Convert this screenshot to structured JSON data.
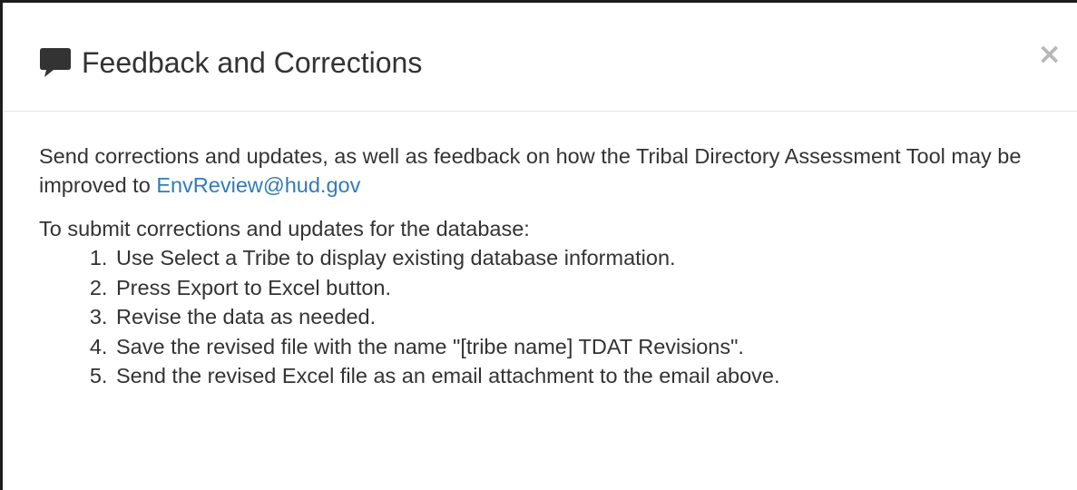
{
  "modal": {
    "title": "Feedback and Corrections",
    "close_label": "×",
    "title_icon": "comment-icon"
  },
  "body": {
    "intro_text": "Send corrections and updates, as well as feedback on how the Tribal Directory Assessment Tool may be improved to ",
    "email_link": "EnvReview@hud.gov",
    "steps_heading": "To submit corrections and updates for the database:",
    "steps": [
      "Use Select a Tribe to display existing database information.",
      "Press Export to Excel button.",
      "Revise the data as needed.",
      "Save the revised file with the name \"[tribe name] TDAT Revisions\".",
      "Send the revised Excel file as an email attachment to the email above."
    ]
  },
  "colors": {
    "link": "#337ab7",
    "text": "#333333",
    "close": "#b8b8b8"
  }
}
